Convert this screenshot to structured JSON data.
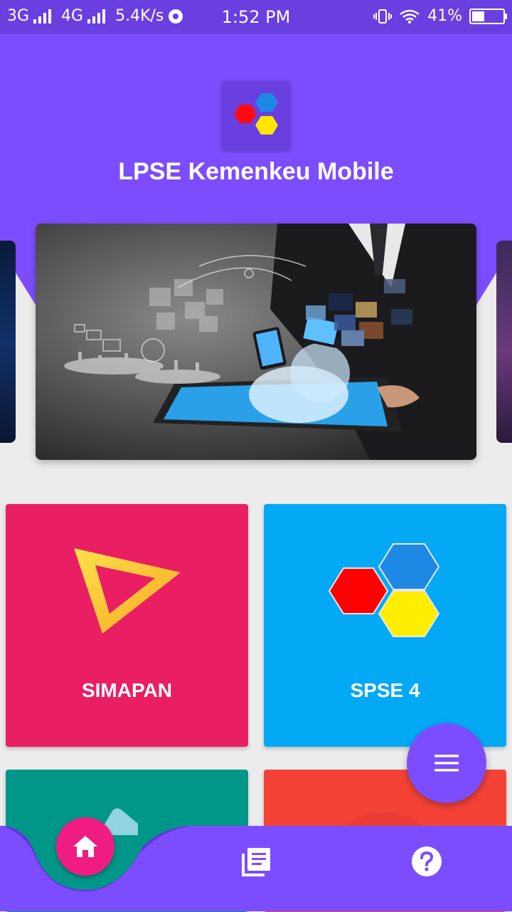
{
  "status_bar": {
    "network1": "3G",
    "network2": "4G",
    "speed": "5.4K/s",
    "time": "1:52 PM",
    "battery_percent": "41%",
    "battery_level": 0.41
  },
  "header": {
    "title": "LPSE Kemenkeu Mobile"
  },
  "menu": {
    "tiles": [
      {
        "label": "SIMAPAN",
        "color": "#e91e63"
      },
      {
        "label": "SPSE 4",
        "color": "#03a9f4"
      },
      {
        "label": "",
        "color": "#009688"
      },
      {
        "label": "",
        "color": "#f44336"
      }
    ]
  },
  "colors": {
    "primary": "#7c4dff",
    "status_bar": "#6a3fe0",
    "home_accent": "#ef1d82"
  },
  "bottom_nav": {
    "items": [
      {
        "icon": "home-icon",
        "active": true
      },
      {
        "icon": "library-books-icon",
        "active": false
      },
      {
        "icon": "help-icon",
        "active": false
      }
    ]
  },
  "fab": {
    "icon": "menu-icon"
  }
}
